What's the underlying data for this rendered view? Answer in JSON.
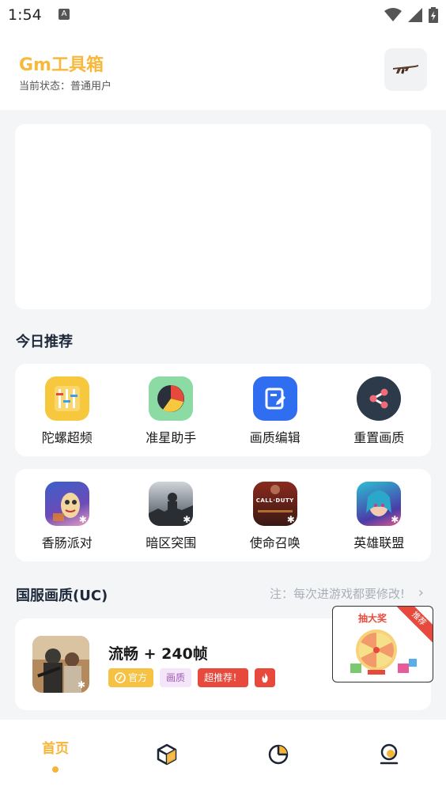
{
  "status_bar": {
    "time": "1:54",
    "notif_letter": "A"
  },
  "header": {
    "title": "Gm工具箱",
    "status_text": "当前状态：普通用户"
  },
  "sections": {
    "today": "今日推荐",
    "cn_quality": "国服画质(UC)"
  },
  "tools": [
    {
      "label": "陀螺超频",
      "icon": "sliders-icon",
      "color": "#f7c83e"
    },
    {
      "label": "准星助手",
      "icon": "pie-icon",
      "color": "#8ddba4"
    },
    {
      "label": "画质编辑",
      "icon": "edit-document-icon",
      "color": "#2f6ef0"
    },
    {
      "label": "重置画质",
      "icon": "share-node-icon",
      "color": "#2d3a4a"
    }
  ],
  "games": [
    {
      "label": "香肠派对",
      "icon": "sausage-party-icon"
    },
    {
      "label": "暗区突围",
      "icon": "arena-breakout-icon"
    },
    {
      "label": "使命召唤",
      "icon": "call-of-duty-icon",
      "logo": "CALL·DUTY"
    },
    {
      "label": "英雄联盟",
      "icon": "league-of-legends-icon"
    }
  ],
  "note": "注：每次进游戏都要修改!",
  "pubg": {
    "title": "流畅 + 240帧",
    "tags": {
      "official": "官方",
      "quality": "画质",
      "hot": "超推荐！"
    }
  },
  "lottery": {
    "title": "抽大奖",
    "ribbon": "推荐"
  },
  "bottom_nav": {
    "home": "首页"
  },
  "colors": {
    "accent": "#f5b638",
    "text": "#1c2433",
    "background": "#f4f5f7"
  }
}
